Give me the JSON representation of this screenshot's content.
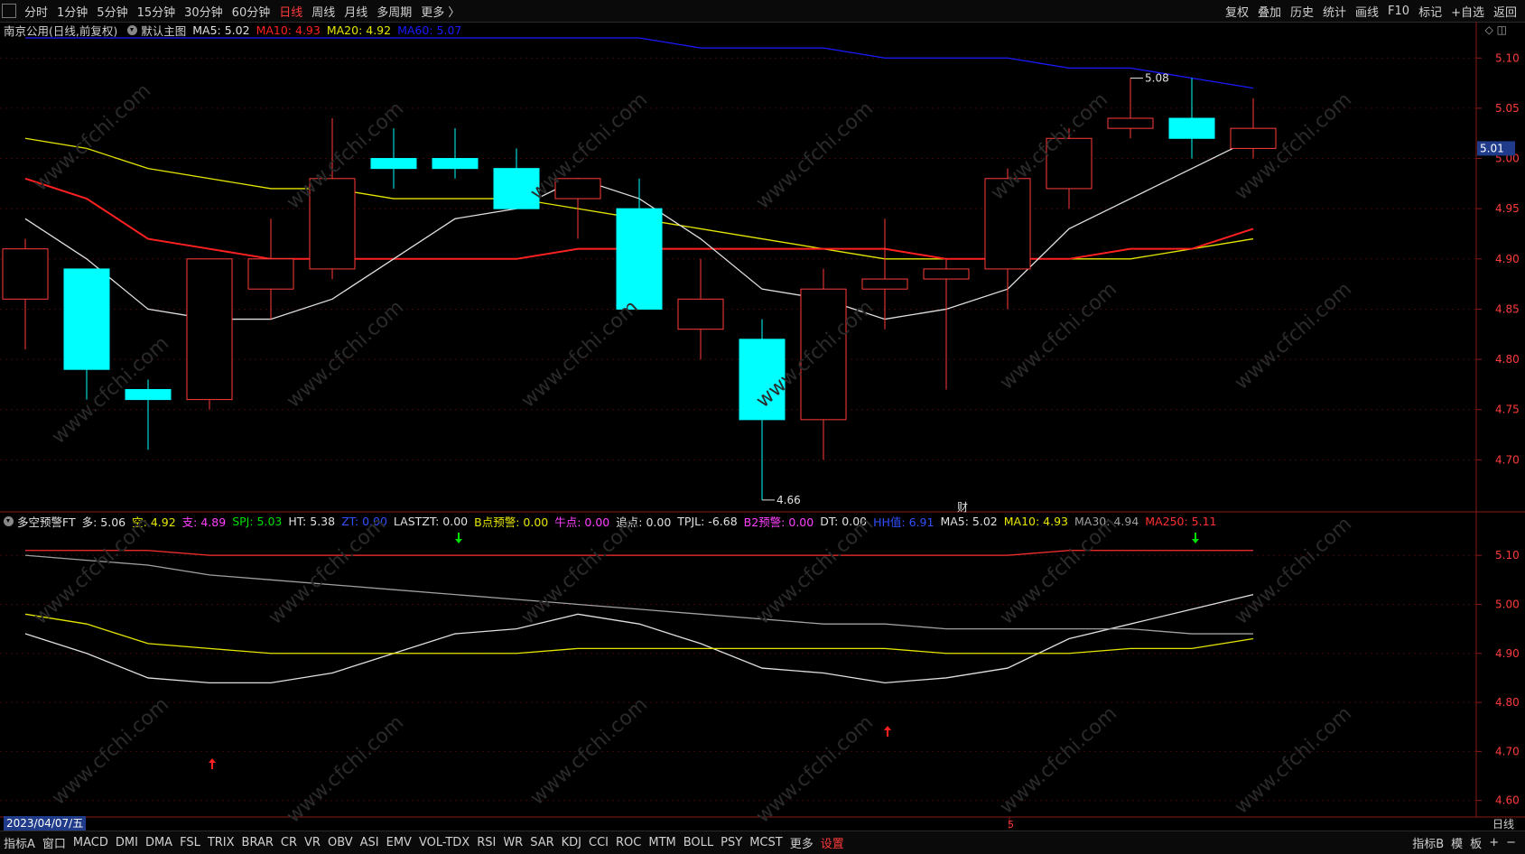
{
  "toolbar": {
    "periods": [
      "分时",
      "1分钟",
      "5分钟",
      "15分钟",
      "30分钟",
      "60分钟",
      "日线",
      "周线",
      "月线",
      "多周期",
      "更多 〉"
    ],
    "active_period": "日线",
    "right_items": [
      "复权",
      "叠加",
      "历史",
      "统计",
      "画线",
      "F10",
      "标记",
      "+自选",
      "返回"
    ]
  },
  "main_header": {
    "title": "南京公用(日线,前复权)",
    "template": "默认主图",
    "ma5": "MA5: 5.02",
    "ma10": "MA10: 4.93",
    "ma20": "MA20: 4.92",
    "ma60": "MA60: 5.07"
  },
  "sub_header": {
    "name": "多空预警FT",
    "items": [
      {
        "text": "多: 5.06",
        "color": "#e0e0e0"
      },
      {
        "text": "空: 4.92",
        "color": "#e6e600"
      },
      {
        "text": "支: 4.89",
        "color": "#ff40ff"
      },
      {
        "text": "SPJ: 5.03",
        "color": "#00e000"
      },
      {
        "text": "HT: 5.38",
        "color": "#e0e0e0"
      },
      {
        "text": "ZT: 0.00",
        "color": "#3050ff"
      },
      {
        "text": "LASTZT: 0.00",
        "color": "#e0e0e0"
      },
      {
        "text": "B点预警: 0.00",
        "color": "#e6e600"
      },
      {
        "text": "牛点: 0.00",
        "color": "#ff40ff"
      },
      {
        "text": "追点: 0.00",
        "color": "#e0e0e0"
      },
      {
        "text": "TPJL: -6.68",
        "color": "#e0e0e0"
      },
      {
        "text": "B2预警: 0.00",
        "color": "#ff40ff"
      },
      {
        "text": "DT: 0.00",
        "color": "#e0e0e0"
      },
      {
        "text": "HH值: 6.91",
        "color": "#3050ff"
      },
      {
        "text": "MA5: 5.02",
        "color": "#e0e0e0"
      },
      {
        "text": "MA10: 4.93",
        "color": "#e6e600"
      },
      {
        "text": "MA30: 4.94",
        "color": "#a0a0a0"
      },
      {
        "text": "MA250: 5.11",
        "color": "#ff3030"
      }
    ]
  },
  "bottom": {
    "date_cursor": "2023/04/07/五",
    "period_label": "日线",
    "month_marker": "5",
    "indicators": [
      "指标A",
      "窗口",
      "MACD",
      "DMI",
      "DMA",
      "FSL",
      "TRIX",
      "BRAR",
      "CR",
      "VR",
      "OBV",
      "ASI",
      "EMV",
      "VOL-TDX",
      "RSI",
      "WR",
      "SAR",
      "KDJ",
      "CCI",
      "ROC",
      "MTM",
      "BOLL",
      "PSY",
      "MCST",
      "更多"
    ],
    "setting": "设置",
    "right_items": [
      "指标B",
      "模",
      "板",
      "+",
      "−"
    ]
  },
  "watermark": "www.cfchi.com",
  "colors": {
    "up": "#ff3b3b",
    "down": "#00ffff",
    "ma5": "#e0e0e0",
    "ma10": "#e6e600",
    "ma20": "#e6e600",
    "ma60": "#1a1aff",
    "ma_red": "#ff2020"
  },
  "chart_data": [
    {
      "type": "candlestick",
      "title": "南京公用(日线,前复权)",
      "ylim": [
        4.65,
        5.12
      ],
      "yticks": [
        "5.10",
        "5.05",
        "5.00",
        "4.95",
        "4.90",
        "4.85",
        "4.80",
        "4.75",
        "4.70"
      ],
      "last_price_tag": "5.01",
      "annotations": [
        {
          "text": "5.08",
          "index": 18,
          "value": 5.08
        },
        {
          "text": "4.66",
          "index": 12,
          "value": 4.66
        },
        {
          "text": "财",
          "index": 15
        }
      ],
      "candles": [
        {
          "o": 4.86,
          "h": 4.92,
          "l": 4.81,
          "c": 4.91
        },
        {
          "o": 4.89,
          "h": 4.89,
          "l": 4.76,
          "c": 4.79
        },
        {
          "o": 4.77,
          "h": 4.78,
          "l": 4.71,
          "c": 4.76
        },
        {
          "o": 4.76,
          "h": 4.9,
          "l": 4.75,
          "c": 4.9
        },
        {
          "o": 4.87,
          "h": 4.94,
          "l": 4.84,
          "c": 4.9
        },
        {
          "o": 4.89,
          "h": 5.04,
          "l": 4.88,
          "c": 4.98
        },
        {
          "o": 5.0,
          "h": 5.03,
          "l": 4.97,
          "c": 4.99
        },
        {
          "o": 5.0,
          "h": 5.03,
          "l": 4.98,
          "c": 4.99
        },
        {
          "o": 4.99,
          "h": 5.01,
          "l": 4.95,
          "c": 4.95
        },
        {
          "o": 4.96,
          "h": 4.98,
          "l": 4.92,
          "c": 4.98
        },
        {
          "o": 4.95,
          "h": 4.98,
          "l": 4.85,
          "c": 4.85
        },
        {
          "o": 4.83,
          "h": 4.9,
          "l": 4.8,
          "c": 4.86
        },
        {
          "o": 4.82,
          "h": 4.84,
          "l": 4.66,
          "c": 4.74
        },
        {
          "o": 4.74,
          "h": 4.89,
          "l": 4.7,
          "c": 4.87
        },
        {
          "o": 4.87,
          "h": 4.94,
          "l": 4.83,
          "c": 4.88
        },
        {
          "o": 4.88,
          "h": 4.9,
          "l": 4.77,
          "c": 4.89
        },
        {
          "o": 4.89,
          "h": 4.99,
          "l": 4.85,
          "c": 4.98
        },
        {
          "o": 4.97,
          "h": 5.03,
          "l": 4.95,
          "c": 5.02
        },
        {
          "o": 5.03,
          "h": 5.08,
          "l": 5.02,
          "c": 5.04
        },
        {
          "o": 5.04,
          "h": 5.08,
          "l": 5.0,
          "c": 5.02
        },
        {
          "o": 5.01,
          "h": 5.06,
          "l": 5.0,
          "c": 5.03
        }
      ],
      "series": [
        {
          "name": "MA5",
          "color": "#e0e0e0",
          "values": [
            4.94,
            4.9,
            4.85,
            4.84,
            4.84,
            4.86,
            4.9,
            4.94,
            4.95,
            4.98,
            4.96,
            4.92,
            4.87,
            4.86,
            4.84,
            4.85,
            4.87,
            4.93,
            4.96,
            4.99,
            5.02
          ]
        },
        {
          "name": "MA10",
          "color": "#ff2020",
          "values": [
            4.98,
            4.96,
            4.92,
            4.91,
            4.9,
            4.9,
            4.9,
            4.9,
            4.9,
            4.91,
            4.91,
            4.91,
            4.91,
            4.91,
            4.91,
            4.9,
            4.9,
            4.9,
            4.91,
            4.91,
            4.93
          ]
        },
        {
          "name": "MA20",
          "color": "#e6e600",
          "values": [
            5.02,
            5.01,
            4.99,
            4.98,
            4.97,
            4.97,
            4.96,
            4.96,
            4.96,
            4.95,
            4.94,
            4.93,
            4.92,
            4.91,
            4.9,
            4.9,
            4.9,
            4.9,
            4.9,
            4.91,
            4.92
          ]
        },
        {
          "name": "MA60",
          "color": "#1a1aff",
          "values": [
            5.12,
            5.12,
            5.12,
            5.12,
            5.12,
            5.12,
            5.12,
            5.12,
            5.12,
            5.12,
            5.12,
            5.11,
            5.11,
            5.11,
            5.1,
            5.1,
            5.1,
            5.09,
            5.09,
            5.08,
            5.07
          ]
        }
      ]
    },
    {
      "type": "line",
      "title": "多空预警FT",
      "ylim": [
        4.57,
        5.15
      ],
      "yticks": [
        "5.10",
        "5.00",
        "4.90",
        "4.80",
        "4.70",
        "4.60"
      ],
      "series": [
        {
          "name": "MA5",
          "color": "#e0e0e0",
          "values": [
            4.94,
            4.9,
            4.85,
            4.84,
            4.84,
            4.86,
            4.9,
            4.94,
            4.95,
            4.98,
            4.96,
            4.92,
            4.87,
            4.86,
            4.84,
            4.85,
            4.87,
            4.93,
            4.96,
            4.99,
            5.02
          ]
        },
        {
          "name": "MA10",
          "color": "#e6e600",
          "values": [
            4.98,
            4.96,
            4.92,
            4.91,
            4.9,
            4.9,
            4.9,
            4.9,
            4.9,
            4.91,
            4.91,
            4.91,
            4.91,
            4.91,
            4.91,
            4.9,
            4.9,
            4.9,
            4.91,
            4.91,
            4.93
          ]
        },
        {
          "name": "MA30",
          "color": "#a0a0a0",
          "values": [
            5.1,
            5.09,
            5.08,
            5.06,
            5.05,
            5.04,
            5.03,
            5.02,
            5.01,
            5.0,
            4.99,
            4.98,
            4.97,
            4.96,
            4.96,
            4.95,
            4.95,
            4.95,
            4.95,
            4.94,
            4.94
          ]
        },
        {
          "name": "MA250",
          "color": "#ff3030",
          "values": [
            5.11,
            5.11,
            5.11,
            5.1,
            5.1,
            5.1,
            5.1,
            5.1,
            5.1,
            5.1,
            5.1,
            5.1,
            5.1,
            5.1,
            5.1,
            5.1,
            5.1,
            5.11,
            5.11,
            5.11,
            5.11
          ]
        }
      ],
      "signals": [
        {
          "index": 7,
          "type": "down",
          "color": "#00e000"
        },
        {
          "index": 19,
          "type": "down",
          "color": "#00e000"
        },
        {
          "index": 3,
          "type": "up",
          "color": "#ff2020"
        },
        {
          "index": 14,
          "type": "up",
          "color": "#ff2020"
        }
      ]
    }
  ]
}
